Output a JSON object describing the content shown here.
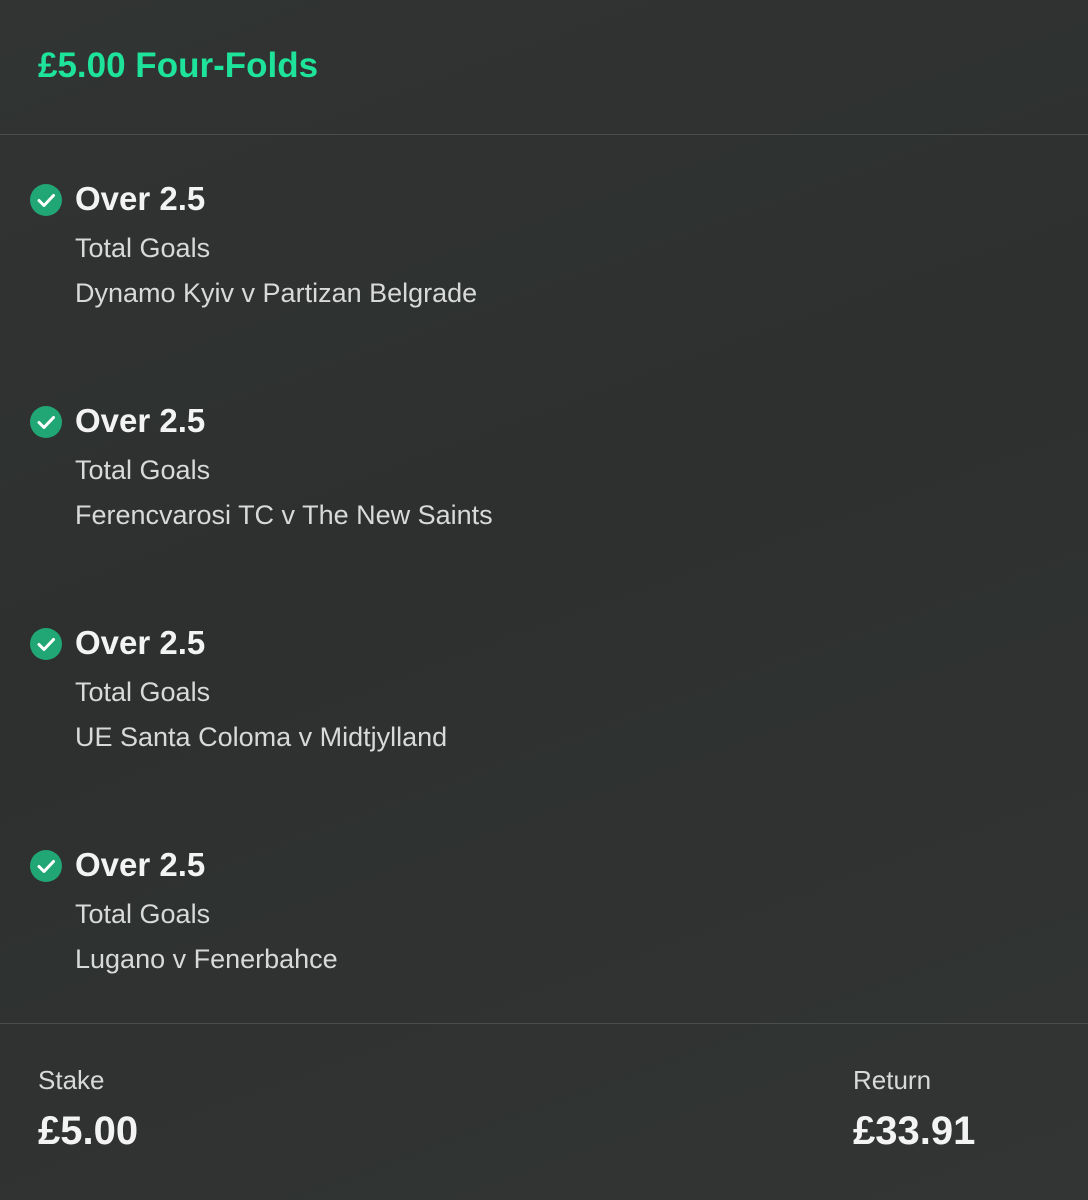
{
  "bet": {
    "title": "£5.00 Four-Folds"
  },
  "colors": {
    "accent": "#1ee39a",
    "success_check": "#21a675"
  },
  "selections": [
    {
      "name": "Over 2.5",
      "market": "Total Goals",
      "event": "Dynamo Kyiv v Partizan Belgrade",
      "status_icon": "check-circle-icon"
    },
    {
      "name": "Over 2.5",
      "market": "Total Goals",
      "event": "Ferencvarosi TC v The New Saints",
      "status_icon": "check-circle-icon"
    },
    {
      "name": "Over 2.5",
      "market": "Total Goals",
      "event": "UE Santa Coloma v Midtjylland",
      "status_icon": "check-circle-icon"
    },
    {
      "name": "Over 2.5",
      "market": "Total Goals",
      "event": "Lugano v Fenerbahce",
      "status_icon": "check-circle-icon"
    }
  ],
  "footer": {
    "stake_label": "Stake",
    "stake_value": "£5.00",
    "return_label": "Return",
    "return_value": "£33.91"
  }
}
